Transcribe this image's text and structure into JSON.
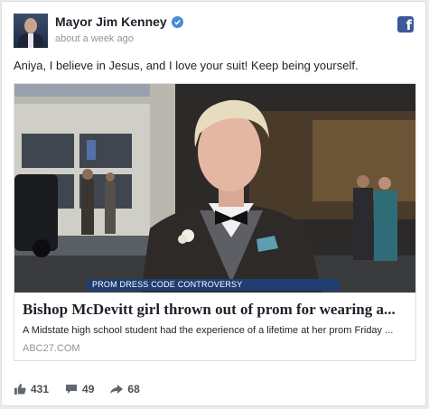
{
  "post": {
    "author": "Mayor Jim Kenney",
    "timestamp": "about a week ago",
    "text": "Aniya, I believe in Jesus, and I love your suit! Keep being yourself."
  },
  "brand": {
    "logo_letter": "f",
    "color": "#3b5998"
  },
  "link": {
    "chyron": "PROM DRESS CODE CONTROVERSY",
    "title": "Bishop McDevitt girl thrown out of prom for wearing a...",
    "description": "A Midstate high school student had the experience of a lifetime at her prom Friday ...",
    "domain": "ABC27.COM"
  },
  "stats": {
    "likes": "431",
    "comments": "49",
    "shares": "68"
  },
  "icons": [
    "verified-badge-icon",
    "facebook-logo-icon",
    "thumbs-up-icon",
    "comment-icon",
    "share-arrow-icon"
  ]
}
